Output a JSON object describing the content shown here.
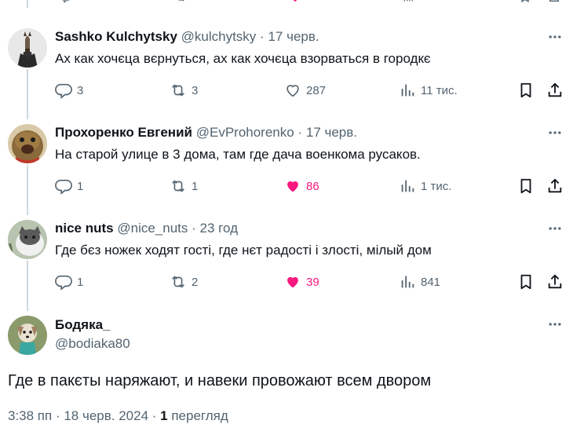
{
  "replies": [
    {
      "name": "Sashko Kulchytsky",
      "handle": "@kulchytsky",
      "date": "17 черв.",
      "text": "Ах как хочєца вєрнуться, ах как хочєца взорваться в городкє",
      "replies": "3",
      "reposts": "3",
      "likes": "287",
      "views": "11 тис.",
      "liked": false,
      "avatar_icon": "bojack-horseman-avatar"
    },
    {
      "name": "Прохоренко Евгений",
      "handle": "@EvProhorenko",
      "date": "17 черв.",
      "text": "На старой улице в 3 дома, там где дача военкома русаков.",
      "replies": "1",
      "reposts": "1",
      "likes": "86",
      "views": "1 тис.",
      "liked": true,
      "avatar_icon": "alf-avatar"
    },
    {
      "name": "nice nuts",
      "handle": "@nice_nuts",
      "date": "23 год",
      "text": "Где бєз ножек ходят гості, где нєт радості і злості, мілый дом",
      "replies": "1",
      "reposts": "2",
      "likes": "39",
      "views": "841",
      "liked": true,
      "avatar_icon": "cat-avatar"
    }
  ],
  "main_post": {
    "name": "Бодяка_",
    "handle": "@bodiaka80",
    "text": "Где в пакєты наряжают, и навеки провожают всем двором",
    "timestamp": "3:38 пп · 18 черв. 2024 · ",
    "views_count": "1",
    "views_label": " перегляд",
    "avatar_icon": "dog-avatar"
  },
  "colors": {
    "text": "#0f1419",
    "secondary": "#536471",
    "like": "#f91880",
    "thread_line": "#cfd9de"
  }
}
